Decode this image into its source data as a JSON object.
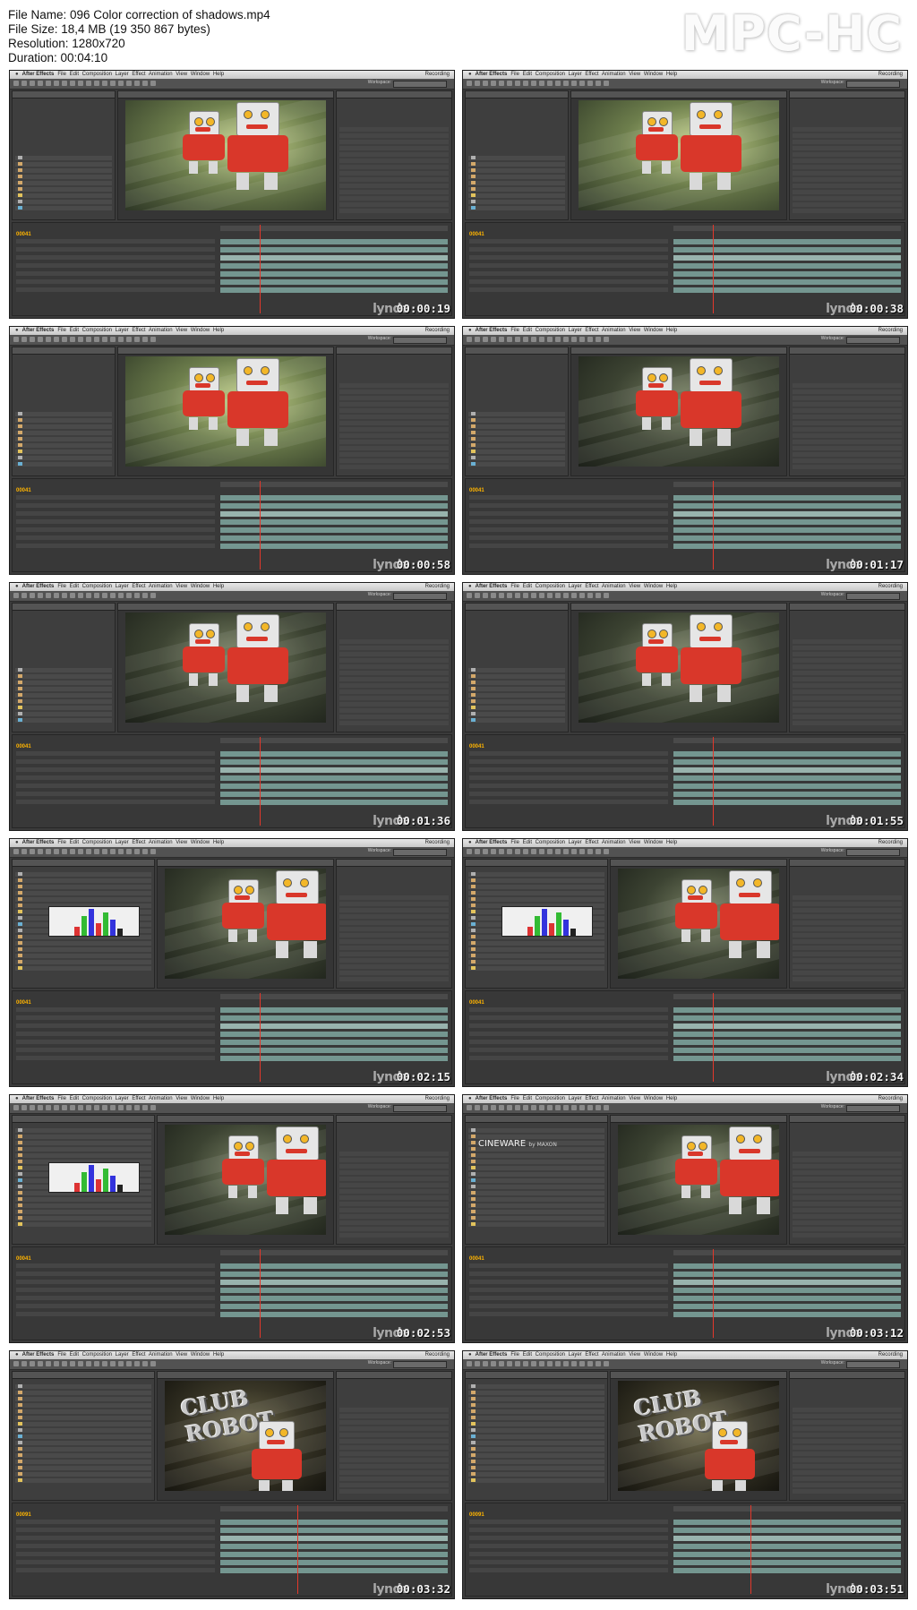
{
  "file_info": {
    "file_name": "File Name: 096 Color correction of shadows.mp4",
    "file_size": "File Size: 18,4 MB (19 350 867 bytes)",
    "resolution": "Resolution: 1280x720",
    "duration": "Duration: 00:04:10"
  },
  "logo": "MPC-HC",
  "watermark": "lynda",
  "app_menu": {
    "apple": "",
    "app_name": "After Effects",
    "items": "File  Edit  Composition  Layer  Effect  Animation  View  Window  Help",
    "workspace_label": "Workspace:",
    "recording": "Recording"
  },
  "colors": {
    "accent_timecode": "#ffb400",
    "playhead": "#e2382b",
    "clip_bar": "#7fa7a0",
    "robot_red": "#d9372a"
  },
  "thumbnails": [
    {
      "timestamp": "00:00:19",
      "layout": "project",
      "scene": "bright",
      "timecode": "00041"
    },
    {
      "timestamp": "00:00:38",
      "layout": "project",
      "scene": "bright",
      "timecode": "00041"
    },
    {
      "timestamp": "00:00:58",
      "layout": "project",
      "scene": "bright",
      "timecode": "00041"
    },
    {
      "timestamp": "00:01:17",
      "layout": "project",
      "scene": "dark",
      "timecode": "00041"
    },
    {
      "timestamp": "00:01:36",
      "layout": "project",
      "scene": "dark",
      "timecode": "00041"
    },
    {
      "timestamp": "00:01:55",
      "layout": "project",
      "scene": "dark",
      "timecode": "00041"
    },
    {
      "timestamp": "00:02:15",
      "layout": "levels",
      "scene": "dark",
      "timecode": "00041"
    },
    {
      "timestamp": "00:02:34",
      "layout": "levels",
      "scene": "dark",
      "timecode": "00041"
    },
    {
      "timestamp": "00:02:53",
      "layout": "levels",
      "scene": "dark",
      "timecode": "00041"
    },
    {
      "timestamp": "00:03:12",
      "layout": "cineware",
      "scene": "dark",
      "timecode": "00041",
      "cineware_title": "CINEWARE",
      "cineware_sub": "by MAXON"
    },
    {
      "timestamp": "00:03:32",
      "layout": "club",
      "scene": "club",
      "timecode": "00091",
      "club_line1": "CLUB",
      "club_line2": "ROBOT"
    },
    {
      "timestamp": "00:03:51",
      "layout": "club",
      "scene": "club",
      "timecode": "00091",
      "club_line1": "CLUB",
      "club_line2": "ROBOT"
    }
  ]
}
